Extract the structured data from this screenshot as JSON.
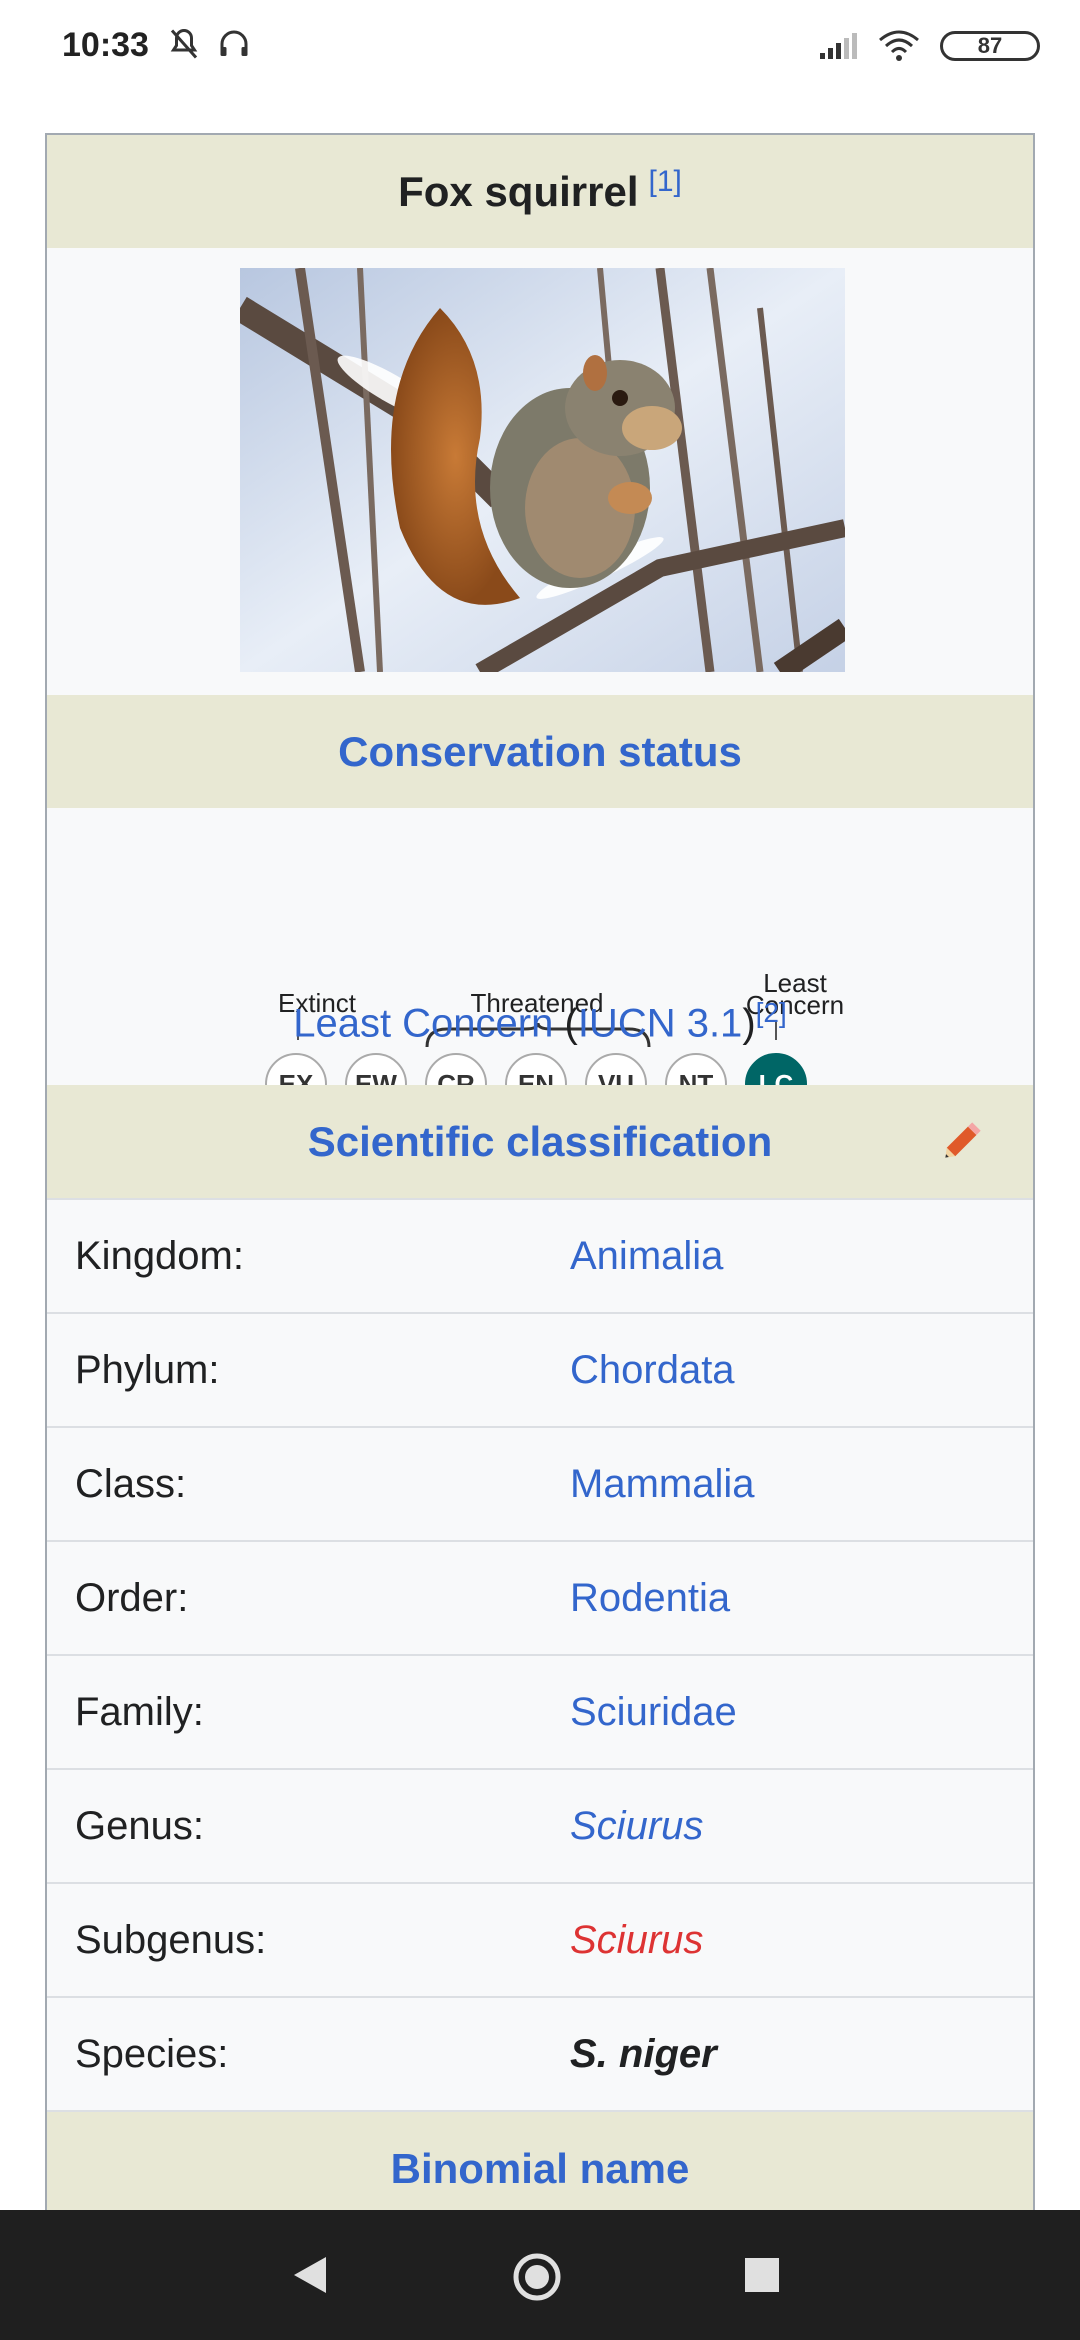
{
  "status_bar": {
    "time": "10:33",
    "battery": "87",
    "icons": [
      "mute-icon",
      "headphones-icon",
      "signal-icon",
      "wifi-icon",
      "battery-icon"
    ]
  },
  "infobox": {
    "title": "Fox squirrel",
    "title_ref": "[1]",
    "image_subject": "fox squirrel on branch in snow",
    "conservation": {
      "header": "Conservation status",
      "labels": {
        "extinct": "Extinct",
        "threatened": "Threatened",
        "least_1": "Least",
        "least_2": "Concern"
      },
      "categories": [
        "EX",
        "EW",
        "CR",
        "EN",
        "VU",
        "NT",
        "LC"
      ],
      "active": "LC",
      "status_text": "Least Concern",
      "open_paren": "(",
      "source": "IUCN 3.1",
      "close_paren": ")",
      "ref": "[2]"
    },
    "classification": {
      "header": "Scientific classification",
      "rows": [
        {
          "label": "Kingdom:",
          "value": "Animalia"
        },
        {
          "label": "Phylum:",
          "value": "Chordata"
        },
        {
          "label": "Class:",
          "value": "Mammalia"
        },
        {
          "label": "Order:",
          "value": "Rodentia"
        },
        {
          "label": "Family:",
          "value": "Sciuridae"
        },
        {
          "label": "Genus:",
          "value": "Sciurus"
        },
        {
          "label": "Subgenus:",
          "value": "Sciurus"
        },
        {
          "label": "Species:",
          "value": "S. niger"
        }
      ]
    },
    "binomial_header": "Binomial name"
  },
  "colors": {
    "link": "#3366cc",
    "redlink": "#dd3333",
    "header_bg": "#e8e8d4",
    "lc": "#006666"
  }
}
